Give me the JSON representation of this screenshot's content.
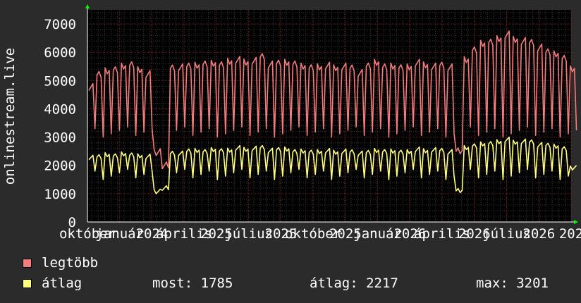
{
  "chart_data": {
    "type": "line",
    "ylabel": "onlinestream.live",
    "ylim": [
      0,
      7500
    ],
    "yticks": [
      0,
      1000,
      2000,
      3000,
      4000,
      5000,
      6000,
      7000
    ],
    "x_tick_labels": [
      "október",
      "január",
      "2024",
      "április",
      "2025",
      "július",
      "2025",
      "október",
      "2025",
      "január",
      "2026",
      "április",
      "2026",
      "július",
      "2026",
      "202"
    ],
    "grid": true,
    "colors": {
      "background": "#2b2b2b",
      "canvas": "#000000",
      "grid_major": "#6e1a1a",
      "grid_minor": "#3a3a3a",
      "axis": "#ffffff",
      "arrow": "#00ff00"
    },
    "series": [
      {
        "name": "legtöbb",
        "color": "#f47c7c",
        "base": [
          4800,
          5200,
          5300,
          5400,
          5500,
          5600,
          5400,
          5200,
          2500,
          2000,
          5400,
          5500,
          5500,
          5500,
          5600,
          5600,
          5600,
          5700,
          5700,
          5700,
          5700,
          5800,
          5600,
          5600,
          5600,
          5600,
          5500,
          5500,
          5500,
          5500,
          5500,
          5500,
          5400,
          5300,
          5500,
          5600,
          5500,
          5500,
          5500,
          5500,
          5600,
          5600,
          5500,
          5500,
          5500,
          2500,
          5700,
          6100,
          6300,
          6400,
          6500,
          6600,
          6500,
          6400,
          6300,
          6200,
          6000,
          5900,
          5800,
          5400
        ],
        "dip_low": 3000
      },
      {
        "name": "átlag",
        "color": "#ffff80",
        "base": [
          2300,
          2300,
          2350,
          2350,
          2400,
          2400,
          2350,
          2300,
          1100,
          1200,
          2400,
          2450,
          2500,
          2500,
          2500,
          2550,
          2550,
          2550,
          2600,
          2600,
          2600,
          2600,
          2550,
          2550,
          2550,
          2500,
          2500,
          2500,
          2500,
          2500,
          2500,
          2500,
          2450,
          2450,
          2450,
          2500,
          2500,
          2500,
          2500,
          2500,
          2550,
          2550,
          2550,
          2500,
          2500,
          1100,
          2600,
          2700,
          2750,
          2800,
          2850,
          2900,
          2850,
          2850,
          2800,
          2750,
          2700,
          2650,
          2600,
          1900
        ],
        "dip_low": 1500
      }
    ],
    "legend": {
      "items": [
        {
          "name": "legtöbb",
          "color": "#f47c7c"
        },
        {
          "name": "átlag",
          "color": "#ffff80"
        }
      ],
      "stats": {
        "most_label": "most:",
        "most_value": "1785",
        "avg_label": "átlag:",
        "avg_value": "2217",
        "max_label": "max:",
        "max_value": "3201"
      }
    }
  }
}
